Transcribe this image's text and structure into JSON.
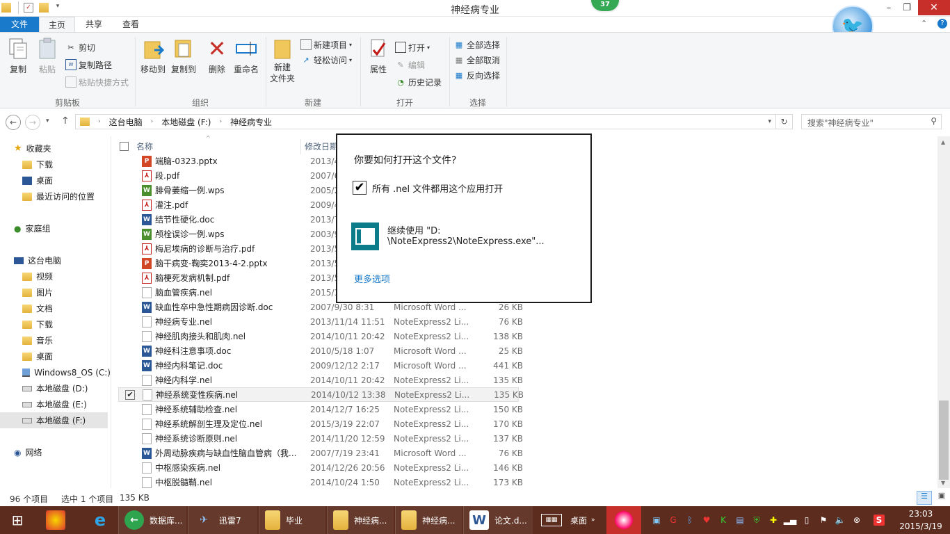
{
  "window": {
    "title": "神经病专业",
    "badge": "37"
  },
  "tabs": {
    "file": "文件",
    "home": "主页",
    "share": "共享",
    "view": "查看"
  },
  "ribbon": {
    "clipboard": {
      "label": "剪贴板",
      "copy": "复制",
      "paste": "粘贴",
      "cut": "剪切",
      "copy_path": "复制路径",
      "paste_shortcut": "粘贴快捷方式"
    },
    "organize": {
      "label": "组织",
      "move_to": "移动到",
      "copy_to": "复制到",
      "delete": "删除",
      "rename": "重命名"
    },
    "new": {
      "label": "新建",
      "new_folder": "新建\n文件夹",
      "new_item": "新建项目",
      "easy_access": "轻松访问"
    },
    "open": {
      "label": "打开",
      "properties": "属性",
      "open": "打开",
      "edit": "编辑",
      "history": "历史记录"
    },
    "select": {
      "label": "选择",
      "select_all": "全部选择",
      "select_none": "全部取消",
      "invert": "反向选择"
    }
  },
  "address": {
    "crumbs": [
      "这台电脑",
      "本地磁盘 (F:)",
      "神经病专业"
    ],
    "search_placeholder": "搜索\"神经病专业\""
  },
  "nav": {
    "favorites": "收藏夹",
    "fav_items": [
      "下载",
      "桌面",
      "最近访问的位置"
    ],
    "homegroup": "家庭组",
    "this_pc": "这台电脑",
    "pc_items": [
      "视频",
      "图片",
      "文档",
      "下载",
      "音乐",
      "桌面",
      "Windows8_OS (C:)",
      "本地磁盘 (D:)",
      "本地磁盘 (E:)",
      "本地磁盘 (F:)"
    ],
    "network": "网络"
  },
  "columns": {
    "name": "名称",
    "date": "修改日期"
  },
  "files": [
    {
      "name": "端脑-0323.pptx",
      "date": "2013/4/",
      "type": "",
      "size": "",
      "kind": "ppt"
    },
    {
      "name": "段.pdf",
      "date": "2007/6/",
      "type": "",
      "size": "",
      "kind": "pdf"
    },
    {
      "name": "腓骨萎缩一例.wps",
      "date": "2005/2/",
      "type": "",
      "size": "",
      "kind": "wps"
    },
    {
      "name": "灌注.pdf",
      "date": "2009/4/",
      "type": "",
      "size": "",
      "kind": "pdf"
    },
    {
      "name": "结节性硬化.doc",
      "date": "2013/7/",
      "type": "",
      "size": "",
      "kind": "doc"
    },
    {
      "name": "颅栓误诊一例.wps",
      "date": "2003/9/",
      "type": "",
      "size": "",
      "kind": "wps"
    },
    {
      "name": "梅尼埃病的诊断与治疗.pdf",
      "date": "2013/5/",
      "type": "",
      "size": "",
      "kind": "pdf"
    },
    {
      "name": "脑干病变-鞠奕2013-4-2.pptx",
      "date": "2013/5/",
      "type": "",
      "size": "",
      "kind": "ppt"
    },
    {
      "name": "脑梗死发病机制.pdf",
      "date": "2013/5/",
      "type": "",
      "size": "",
      "kind": "pdf"
    },
    {
      "name": "脑血管疾病.nel",
      "date": "2015/3/",
      "type": "",
      "size": "",
      "kind": "nel"
    },
    {
      "name": "缺血性卒中急性期病因诊断.doc",
      "date": "2007/9/30 8:31",
      "type": "Microsoft Word ...",
      "size": "26 KB",
      "kind": "doc"
    },
    {
      "name": "神经病专业.nel",
      "date": "2013/11/14 11:51",
      "type": "NoteExpress2 Li...",
      "size": "76 KB",
      "kind": "nel"
    },
    {
      "name": "神经肌肉接头和肌肉.nel",
      "date": "2014/10/11 20:42",
      "type": "NoteExpress2 Li...",
      "size": "138 KB",
      "kind": "nel"
    },
    {
      "name": "神经科注意事项.doc",
      "date": "2010/5/18 1:07",
      "type": "Microsoft Word ...",
      "size": "25 KB",
      "kind": "doc"
    },
    {
      "name": "神经内科笔记.doc",
      "date": "2009/12/12 2:17",
      "type": "Microsoft Word ...",
      "size": "441 KB",
      "kind": "doc"
    },
    {
      "name": "神经内科学.nel",
      "date": "2014/10/11 20:42",
      "type": "NoteExpress2 Li...",
      "size": "135 KB",
      "kind": "nel"
    },
    {
      "name": "神经系统变性疾病.nel",
      "date": "2014/10/12 13:38",
      "type": "NoteExpress2 Li...",
      "size": "135 KB",
      "kind": "nel",
      "selected": true
    },
    {
      "name": "神经系统辅助检查.nel",
      "date": "2014/12/7 16:25",
      "type": "NoteExpress2 Li...",
      "size": "150 KB",
      "kind": "nel"
    },
    {
      "name": "神经系统解剖生理及定位.nel",
      "date": "2015/3/19 22:07",
      "type": "NoteExpress2 Li...",
      "size": "170 KB",
      "kind": "nel"
    },
    {
      "name": "神经系统诊断原则.nel",
      "date": "2014/11/20 12:59",
      "type": "NoteExpress2 Li...",
      "size": "137 KB",
      "kind": "nel"
    },
    {
      "name": "外周动脉疾病与缺血性脑血管病（我...",
      "date": "2007/7/19 23:41",
      "type": "Microsoft Word ...",
      "size": "76 KB",
      "kind": "doc"
    },
    {
      "name": "中枢感染疾病.nel",
      "date": "2014/12/26 20:56",
      "type": "NoteExpress2 Li...",
      "size": "146 KB",
      "kind": "nel"
    },
    {
      "name": "中枢脱髓鞘.nel",
      "date": "2014/10/24 1:50",
      "type": "NoteExpress2 Li...",
      "size": "173 KB",
      "kind": "nel"
    }
  ],
  "status": {
    "count": "96 个项目",
    "selected": "选中 1 个项目",
    "size": "135 KB"
  },
  "dialog": {
    "title": "你要如何打开这个文件?",
    "checkbox_label": "所有 .nel 文件都用这个应用打开",
    "app_line1": "继续使用 \"D:",
    "app_line2": "\\NoteExpress2\\NoteExpress.exe\"...",
    "more": "更多选项"
  },
  "taskbar": {
    "items": [
      "数据库...",
      "迅雷7",
      "毕业",
      "神经病...",
      "神经病...",
      "论文.d...",
      "桌面"
    ],
    "time": "23:03",
    "date": "2015/3/19"
  },
  "colors": {
    "accent": "#1979ca",
    "taskbar": "#5c2d1e",
    "close": "#c7302a"
  }
}
